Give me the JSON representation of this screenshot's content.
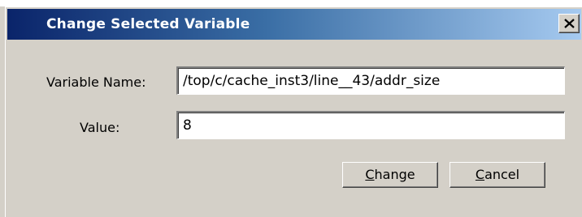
{
  "dialog": {
    "title": "Change Selected Variable",
    "close_label": "X"
  },
  "fields": {
    "variable_name_label": "Variable Name:",
    "variable_name_value": "/top/c/cache_inst3/line__43/addr_size",
    "value_label": "Value:",
    "value_value": "8"
  },
  "buttons": {
    "change": {
      "mnemonic": "C",
      "rest": "hange"
    },
    "cancel": {
      "mnemonic": "C",
      "rest": "ancel"
    }
  },
  "colors": {
    "titlebar_start": "#0a246a",
    "titlebar_end": "#a6caf0",
    "face": "#d4d0c8"
  }
}
